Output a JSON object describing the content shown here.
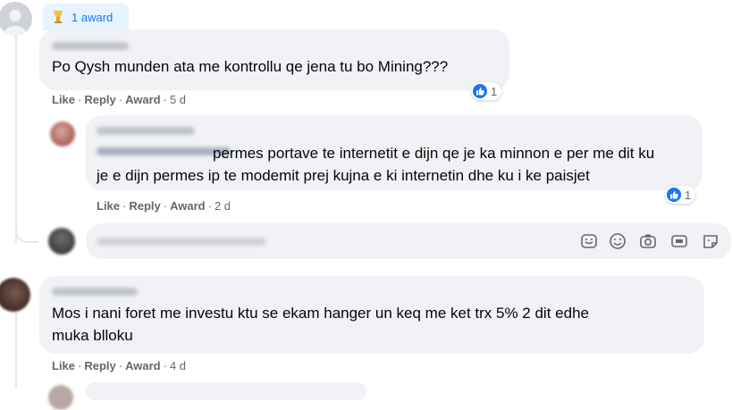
{
  "award_badge": {
    "label": "1 award"
  },
  "comments": [
    {
      "text": "Po Qysh munden ata me kontrollu qe jena tu bo Mining???",
      "reaction_count": "1",
      "actions": {
        "like": "Like",
        "reply": "Reply",
        "award": "Award",
        "time": "5 d"
      }
    },
    {
      "text_line1": "permes portave te internetit e dijn qe je ka minnon e per me dit ku",
      "text_line2": "je e dijn permes ip te modemit prej kujna e ki internetin dhe ku i ke paisjet",
      "reaction_count": "1",
      "actions": {
        "like": "Like",
        "reply": "Reply",
        "award": "Award",
        "time": "2 d"
      }
    },
    {
      "text_line1": "Mos i nani foret me investu ktu se ekam hanger un keq me ket trx 5% 2 dit edhe",
      "text_line2": "muka blloku",
      "actions": {
        "like": "Like",
        "reply": "Reply",
        "award": "Award",
        "time": "4 d"
      }
    }
  ],
  "reply_composer": {
    "icons": [
      "sticker-icon",
      "emoji-icon",
      "camera-icon",
      "gif-icon",
      "sticker-pack-icon"
    ]
  },
  "colors": {
    "accent": "#1877f2",
    "bubble": "#f0f2f5",
    "meta": "#65676b"
  }
}
